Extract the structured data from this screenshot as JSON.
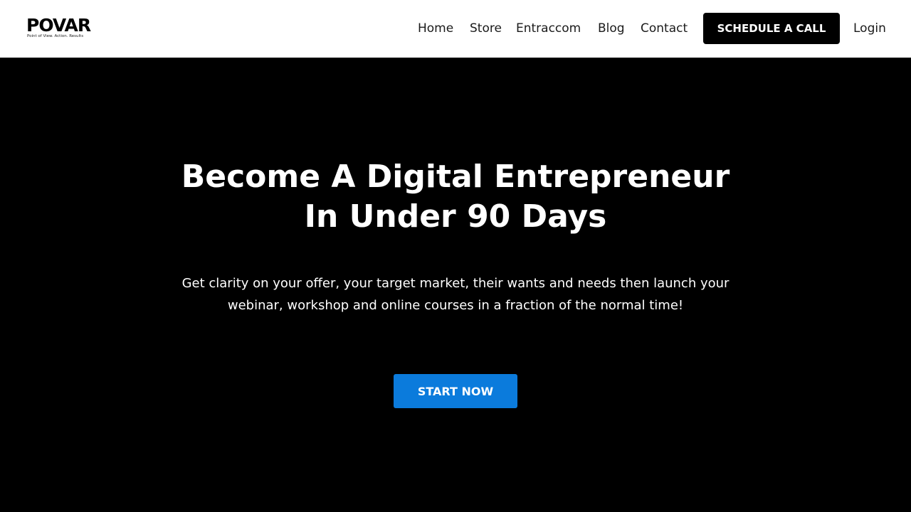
{
  "header": {
    "logo": {
      "wordmark": "POVAR",
      "tagline": "Point of View. Action. Results"
    },
    "nav": [
      {
        "label": "Home"
      },
      {
        "label": "Store"
      },
      {
        "label": "Entraccom"
      },
      {
        "label": "Blog"
      },
      {
        "label": "Contact"
      }
    ],
    "cta_label": "SCHEDULE A CALL",
    "login_label": "Login"
  },
  "hero": {
    "title_line1": "Become A Digital Entrepreneur",
    "title_line2": "In Under 90 Days",
    "subtitle": "Get clarity on your offer, your target market, their wants and needs then launch your webinar, workshop and online courses in a fraction of the normal time!",
    "cta_label": "START NOW"
  },
  "colors": {
    "header_bg": "#ffffff",
    "hero_bg": "#000000",
    "header_cta_bg": "#000000",
    "primary_cta_bg": "#0b7bdc",
    "text_light": "#ffffff",
    "text_dark": "#1a1a1a"
  }
}
